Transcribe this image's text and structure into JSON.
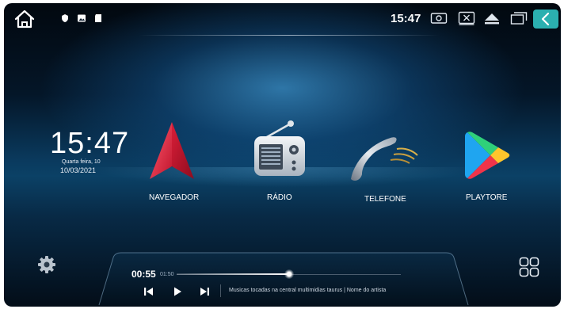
{
  "statusbar": {
    "time": "15:47",
    "icons": [
      "home-icon",
      "shield-icon",
      "image-icon",
      "sd-card-icon",
      "screenshot-icon",
      "close-app-icon",
      "eject-icon",
      "recent-apps-icon",
      "back-icon"
    ],
    "back_button_color": "#2bb0b0"
  },
  "clock": {
    "time": "15:47",
    "day": "Quarta feira, 10",
    "date": "10/03/2021"
  },
  "apps": [
    {
      "label": "NAVEGADOR",
      "icon": "navigation-arrow-icon"
    },
    {
      "label": "RÁDIO",
      "icon": "radio-icon"
    },
    {
      "label": "TELEFONE",
      "icon": "phone-icon"
    },
    {
      "label": "PLAYTORE",
      "icon": "play-store-icon"
    }
  ],
  "player": {
    "current_time": "00:55",
    "total_time": "01:50",
    "progress": 0.5,
    "track_info": "Musicas  tocadas na central multimidias taurus | Nome do artista",
    "controls": [
      "previous-icon",
      "play-icon",
      "next-icon"
    ]
  },
  "colors": {
    "accent": "#2bb0b0",
    "nav_red": "#e8334a"
  }
}
